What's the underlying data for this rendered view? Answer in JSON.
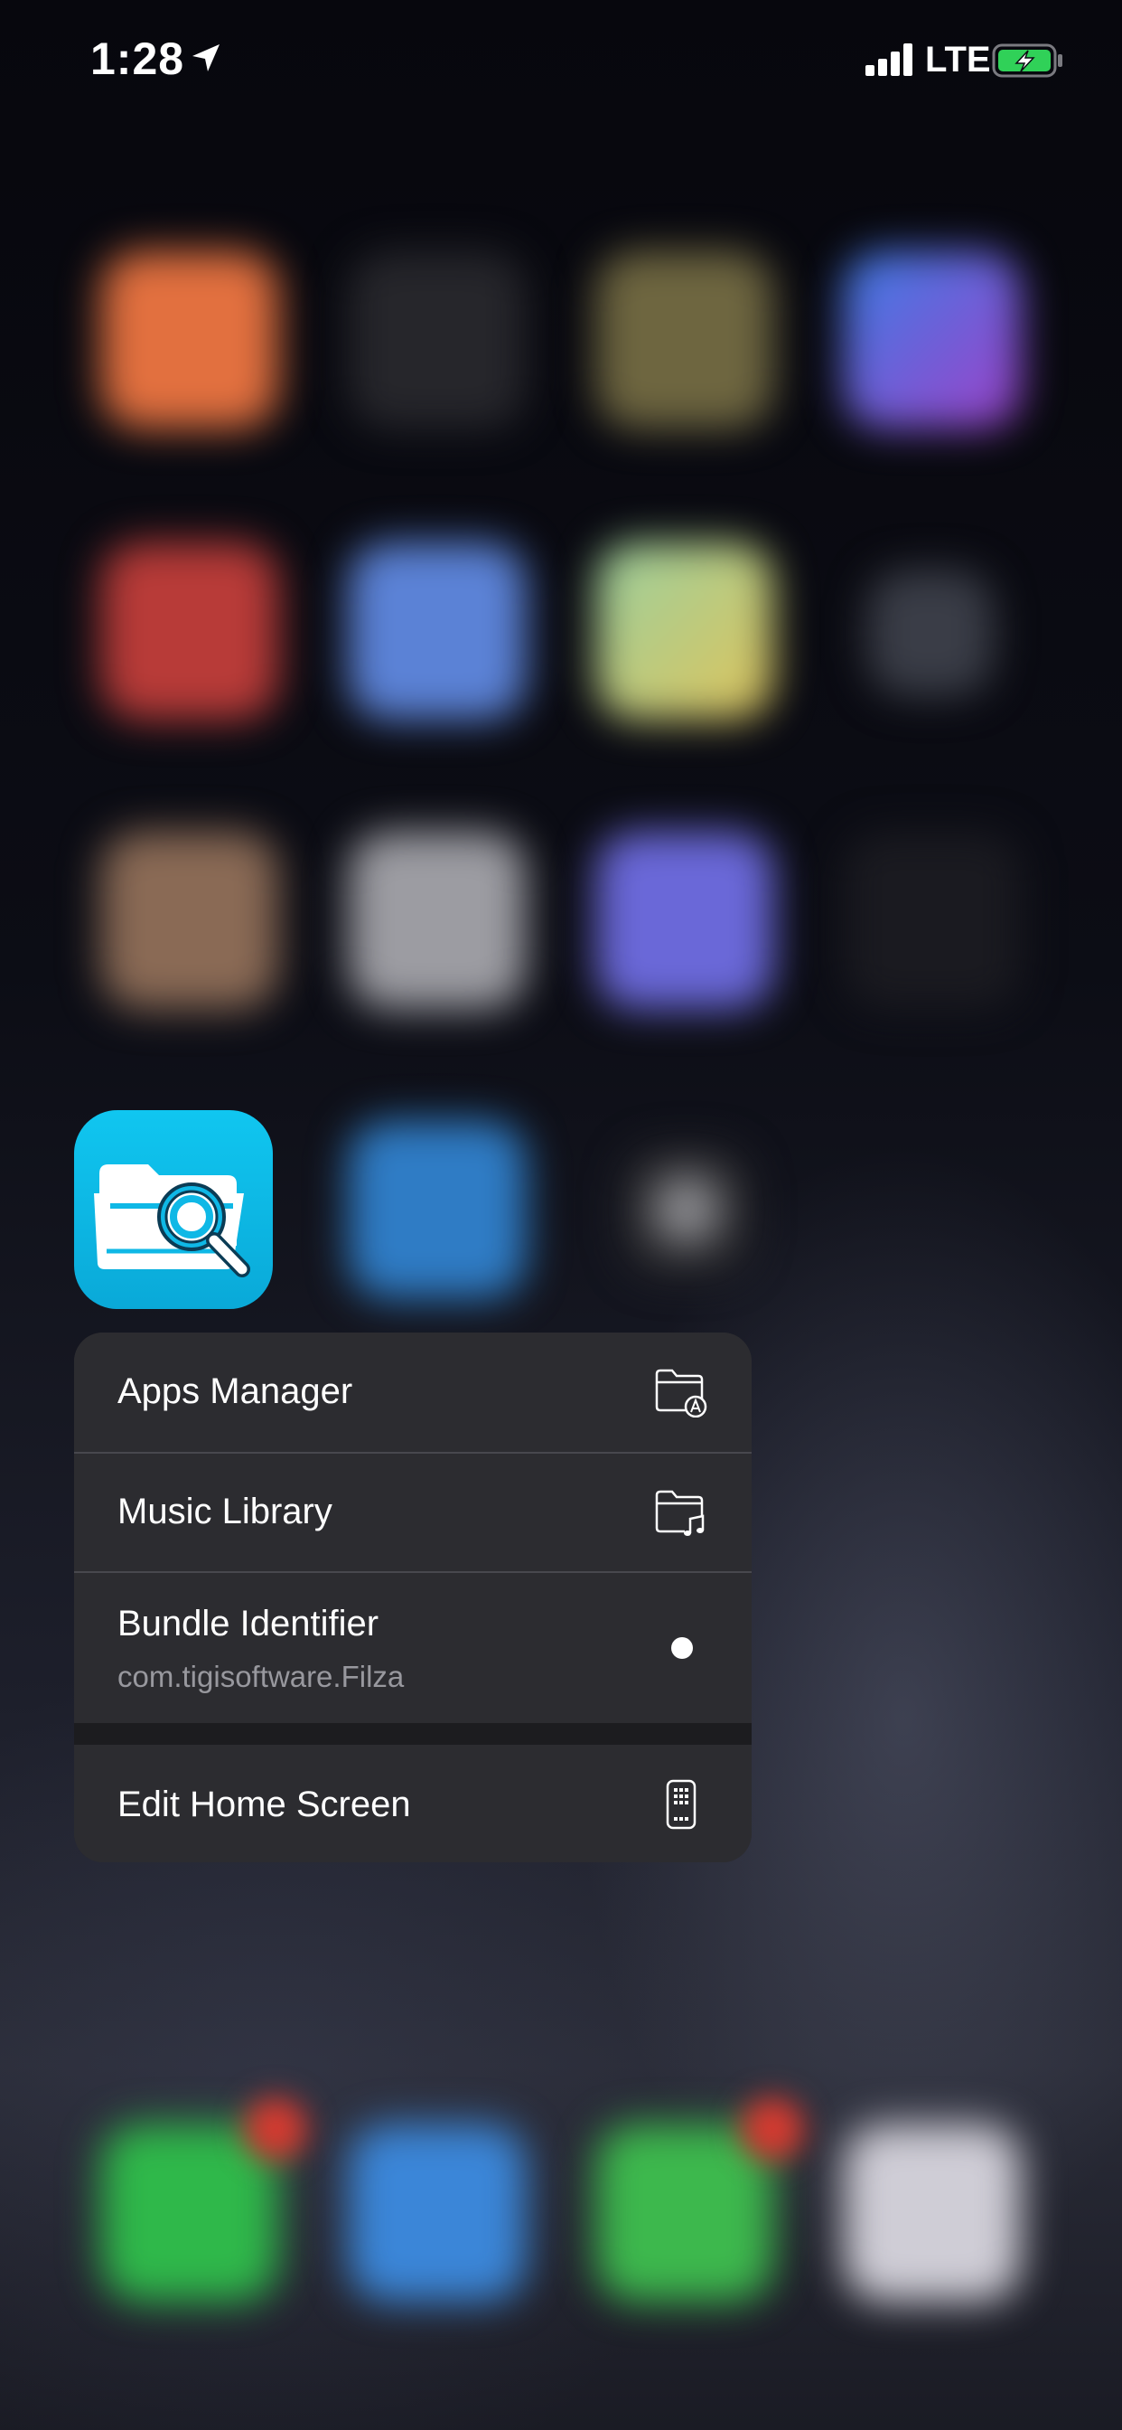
{
  "status_bar": {
    "time": "1:28",
    "network": "LTE",
    "icons": [
      "location-arrow-icon",
      "cellular-signal-icon",
      "battery-charging-icon"
    ],
    "battery_color": "#30d158"
  },
  "focused_app": {
    "icon": "folder-magnifier-icon",
    "color": "#0fb8e6"
  },
  "context_menu": {
    "items": [
      {
        "label": "Apps Manager",
        "icon": "folder-app-store-icon"
      },
      {
        "label": "Music Library",
        "icon": "folder-music-icon"
      },
      {
        "label": "Bundle Identifier",
        "subtitle": "com.tigisoftware.Filza",
        "icon": "dot-icon"
      },
      {
        "label": "Edit Home Screen",
        "icon": "phone-apps-icon"
      }
    ]
  }
}
